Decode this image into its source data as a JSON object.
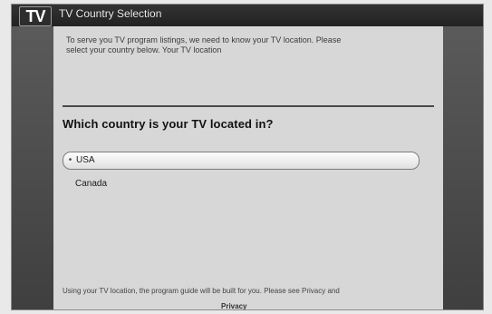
{
  "window": {
    "logo": "TV",
    "title": "TV Country Selection"
  },
  "content": {
    "intro_lines": [
      "To serve you TV program listings, we need to know your TV location. Please",
      "select your country below. Your TV location"
    ],
    "question": "Which country is your TV located in?",
    "options": [
      {
        "label": "USA",
        "selected": true
      },
      {
        "label": "Canada",
        "selected": false
      }
    ],
    "footer_lines": [
      "Using your TV location, the program guide will be built for you. Please see Privacy and"
    ],
    "footer_link": "Privacy"
  },
  "colors": {
    "titlebar": "#222222",
    "panel": "#d7d7d7",
    "rail": "#4a4a4a",
    "selected_option": "#efefef",
    "divider": "#4a4a4a"
  }
}
